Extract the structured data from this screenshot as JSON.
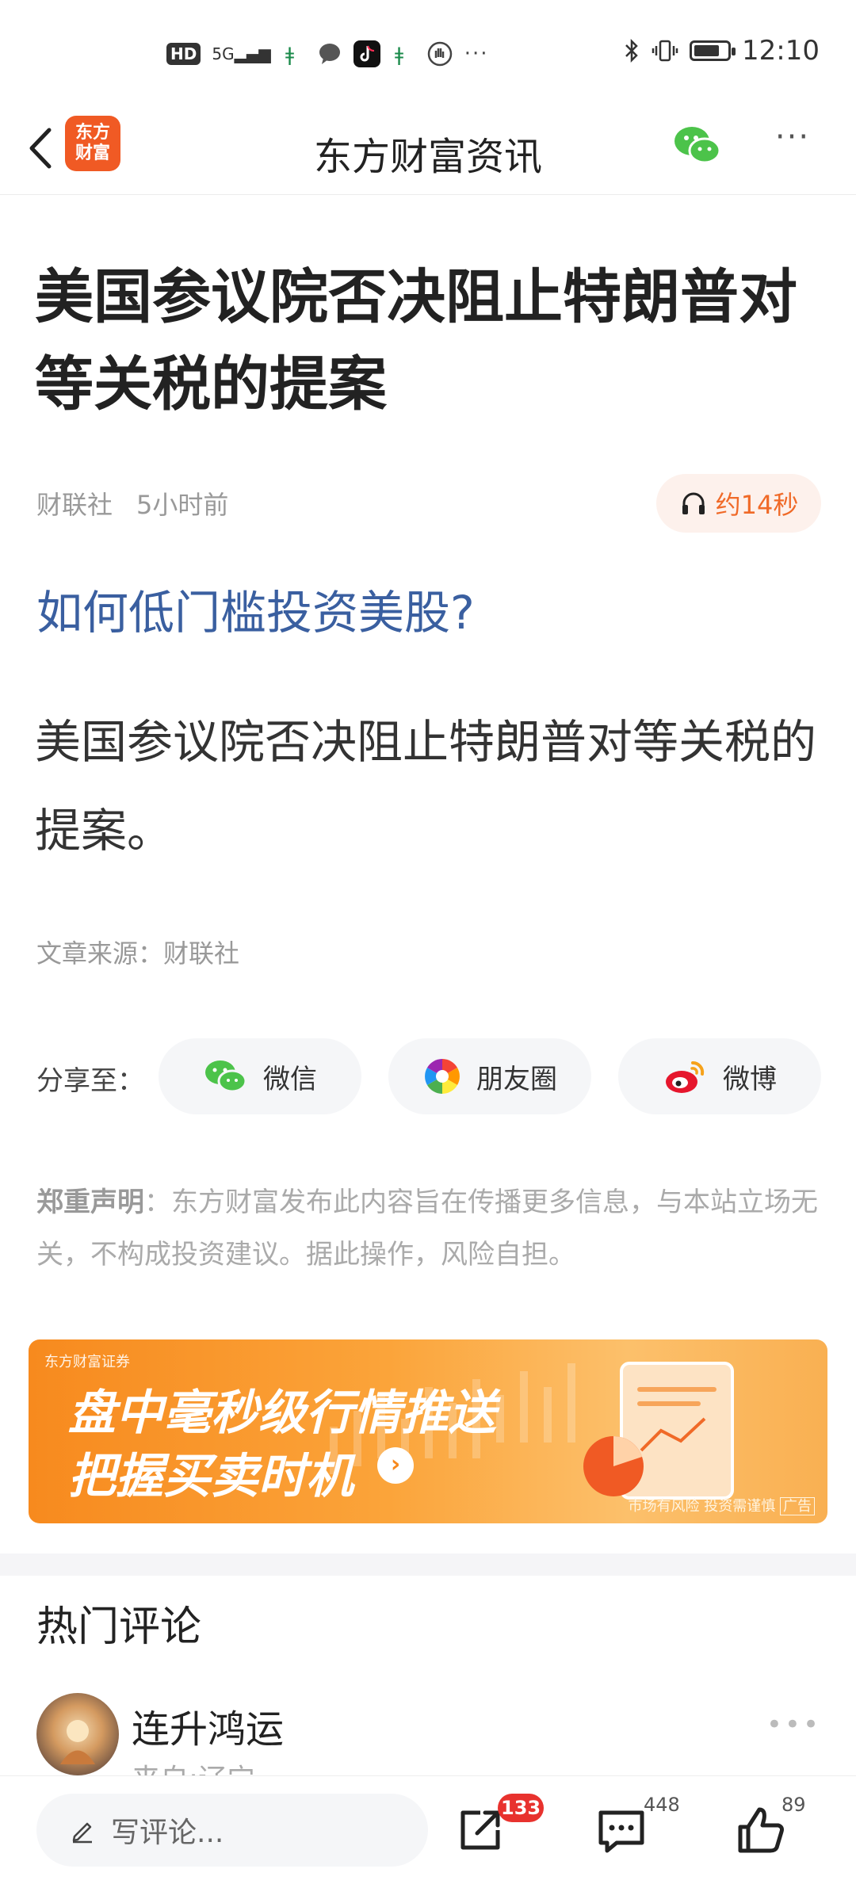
{
  "status_bar": {
    "network_badge": "HD",
    "signal_text": "5G",
    "more_icons": "···",
    "time": "12:10",
    "battery_level": 0.8
  },
  "nav": {
    "logo_line1": "东方",
    "logo_line2": "财富",
    "title": "东方财富资讯",
    "more": "···"
  },
  "article": {
    "headline": "美国参议院否决阻止特朗普对等关税的提案",
    "source_name": "财联社",
    "time_ago": "5小时前",
    "audio_duration": "约14秒",
    "promo_link": "如何低门槛投资美股?",
    "body": "美国参议院否决阻止特朗普对等关税的提案。",
    "source_line": "文章来源：财联社"
  },
  "share": {
    "label": "分享至：",
    "wechat": "微信",
    "moments": "朋友圈",
    "weibo": "微博"
  },
  "disclaimer": {
    "title": "郑重声明",
    "text": "：东方财富发布此内容旨在传播更多信息，与本站立场无关，不构成投资建议。据此操作，风险自担。"
  },
  "banner": {
    "brand": "东方财富证券",
    "line1": "盘中毫秒级行情推送",
    "line2": "把握买卖时机",
    "risk_note": "市场有风险 投资需谨慎",
    "ad_tag": "广告",
    "colors": {
      "start": "#f78a1e",
      "end": "#fcc06b"
    }
  },
  "comments": {
    "title": "热门评论",
    "items": [
      {
        "user": "连升鸿运",
        "location": "来自:辽宁"
      }
    ]
  },
  "bottom_bar": {
    "comment_placeholder": "写评论...",
    "share_count": "133",
    "comment_count": "448",
    "like_count": "89"
  }
}
